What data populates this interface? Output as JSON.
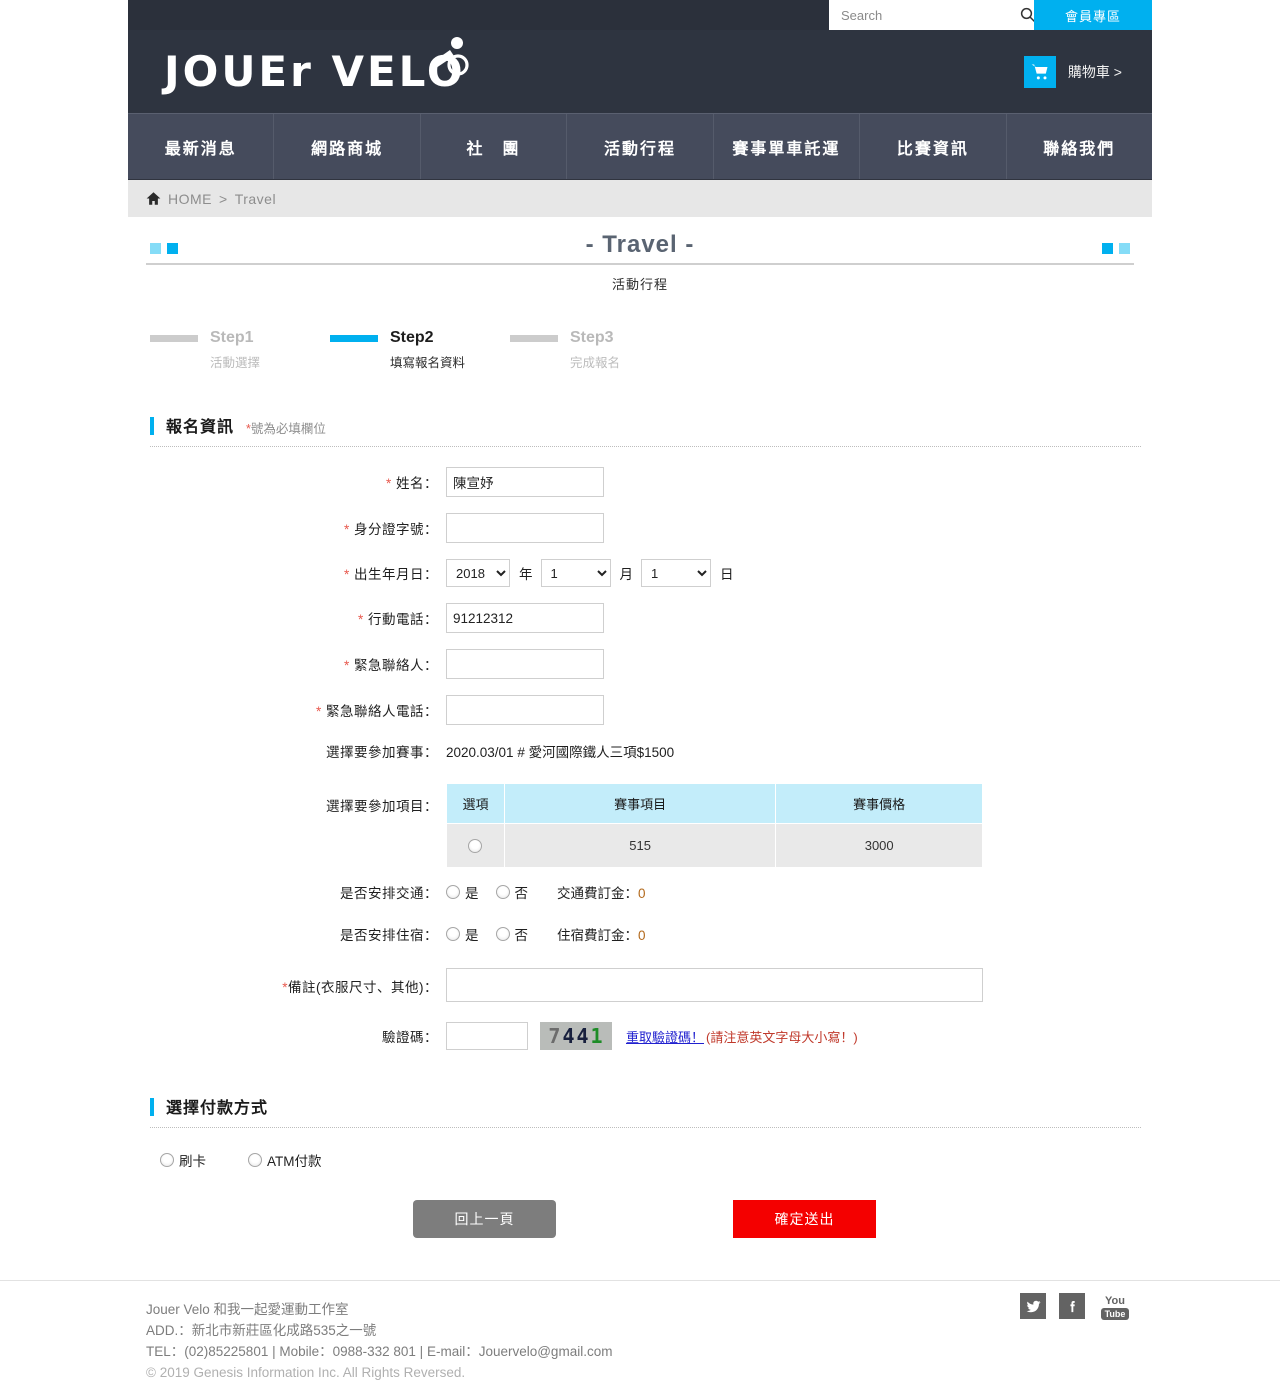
{
  "topbar": {
    "search_placeholder": "Search",
    "search_value": "",
    "search_icon": "search-icon",
    "member_label": "會員專區"
  },
  "logobar": {
    "brand": "JOUEr VELO",
    "cart_icon": "shopping-cart-icon",
    "cart_label": "購物車 >"
  },
  "nav": {
    "items": [
      {
        "label": "最新消息"
      },
      {
        "label": "網路商城"
      },
      {
        "label": "社　團"
      },
      {
        "label": "活動行程"
      },
      {
        "label": "賽事單車託運"
      },
      {
        "label": "比賽資訊"
      },
      {
        "label": "聯絡我們"
      }
    ]
  },
  "breadcrumb": {
    "home_icon": "home-icon",
    "home": "HOME",
    "separator": ">",
    "current": "Travel"
  },
  "title": {
    "main": "- Travel -",
    "sub": "活動行程"
  },
  "steps": [
    {
      "label": "Step1",
      "desc": "活動選擇",
      "active": false
    },
    {
      "label": "Step2",
      "desc": "填寫報名資料",
      "active": true
    },
    {
      "label": "Step3",
      "desc": "完成報名",
      "active": false
    }
  ],
  "registration": {
    "section_title": "報名資訊",
    "required_note_mark": "*",
    "required_note": "號為必填欄位",
    "fields": {
      "name_label": "姓名：",
      "name_value": "陳宣妤",
      "id_label": "身分證字號：",
      "id_value": "",
      "birth_label": "出生年月日：",
      "birth_year": "2018",
      "birth_year_unit": "年",
      "birth_month": "1",
      "birth_month_unit": "月",
      "birth_day": "1",
      "birth_day_unit": "日",
      "mobile_label": "行動電話：",
      "mobile_value": "91212312",
      "emergency_label": "緊急聯絡人：",
      "emergency_value": "",
      "emergency_phone_label": "緊急聯絡人電話：",
      "emergency_phone_value": "",
      "event_label": "選擇要參加賽事：",
      "event_value": "2020.03/01 # 愛河國際鐵人三項$1500",
      "item_label": "選擇要參加項目：",
      "transport_label": "是否安排交通：",
      "transport_yes": "是",
      "transport_no": "否",
      "transport_fee_label": "交通費訂金：",
      "transport_fee_value": "0",
      "lodging_label": "是否安排住宿：",
      "lodging_yes": "是",
      "lodging_no": "否",
      "lodging_fee_label": "住宿費訂金：",
      "lodging_fee_value": "0",
      "memo_label_mark": "*",
      "memo_label": "備註(衣服尺寸、其他)：",
      "memo_value": "",
      "captcha_label": "驗證碼：",
      "captcha_value": "",
      "captcha_digits": [
        "7",
        "4",
        "4",
        "1"
      ],
      "captcha_refresh": "重取驗證碼！",
      "captcha_hint": "(請注意英文字母大小寫！)"
    },
    "table": {
      "headers": [
        "選項",
        "賽事項目",
        "賽事價格"
      ],
      "rows": [
        {
          "option": "",
          "item": "515",
          "price": "3000"
        }
      ]
    }
  },
  "payment": {
    "section_title": "選擇付款方式",
    "options": [
      {
        "label": "刷卡"
      },
      {
        "label": "ATM付款"
      }
    ],
    "back_button": "回上一頁",
    "submit_button": "確定送出"
  },
  "footer": {
    "line1": "Jouer Velo 和我一起愛運動工作室",
    "line2": "ADD.：新北市新莊區化成路535之一號",
    "line3": "TEL：(02)85225801 | Mobile：0988-332 801 | E-mail：Jouervelo@gmail.com",
    "copyright": "© 2019 Genesis Information Inc. All Rights Reversed.",
    "socials": [
      {
        "name": "twitter-icon"
      },
      {
        "name": "facebook-icon"
      },
      {
        "name": "youtube-icon",
        "top": "You",
        "bottom": "Tube"
      }
    ]
  },
  "colors": {
    "accent": "#00b0ef",
    "dark": "#2e3440",
    "nav": "#454b5c",
    "submit": "#f40000",
    "back": "#7d7d7d",
    "table_header": "#c3edfa"
  }
}
